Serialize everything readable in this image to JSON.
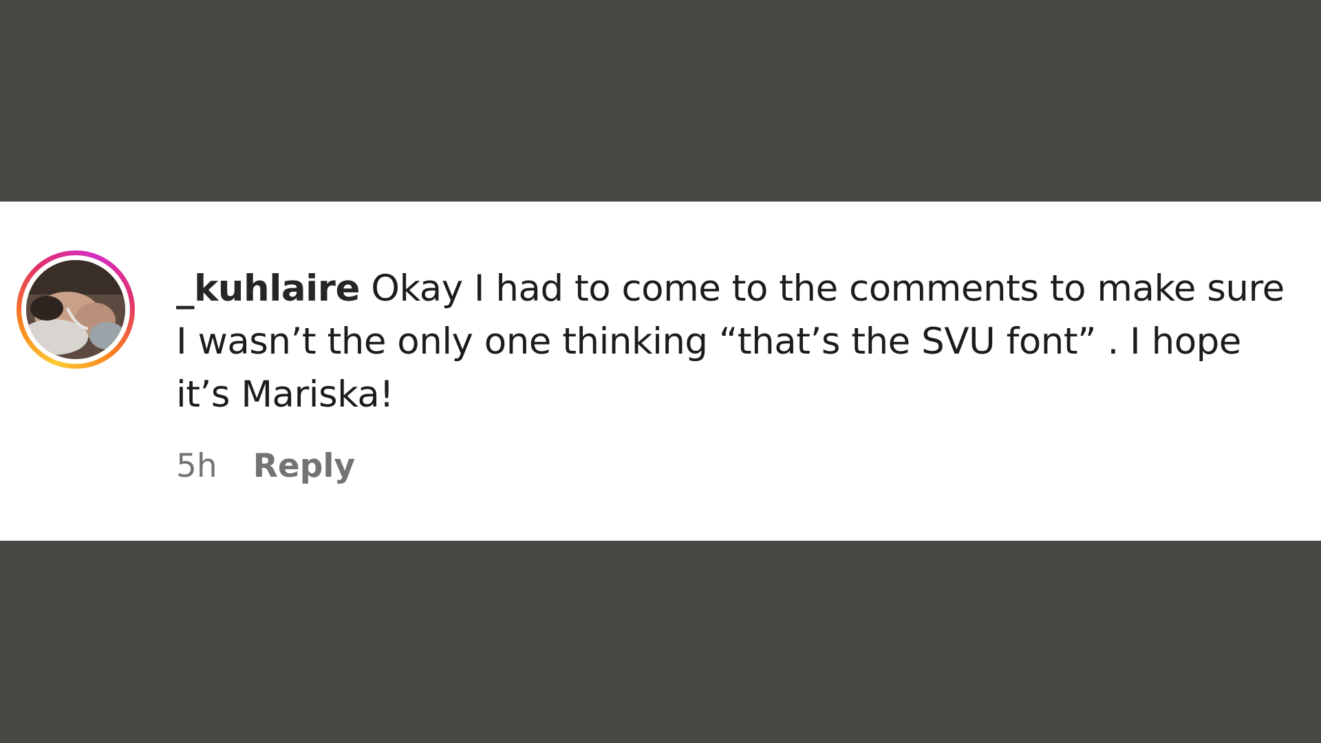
{
  "comment": {
    "username": "_kuhlaire",
    "text": "Okay I had to come to the comments to make sure I wasn’t the only one thinking “that’s the SVU font” . I hope it’s Mariska!",
    "timestamp": "5h",
    "reply_label": "Reply",
    "avatar_ring_colors": [
      "#fdcb32",
      "#fa7e1e",
      "#e1306c",
      "#d62ec4"
    ]
  }
}
